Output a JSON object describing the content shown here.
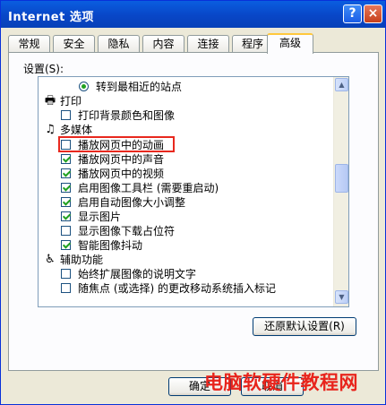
{
  "window": {
    "title": "Internet 选项",
    "help_button": "?",
    "close_button": "×"
  },
  "tabs": [
    {
      "label": "常规",
      "active": false
    },
    {
      "label": "安全",
      "active": false
    },
    {
      "label": "隐私",
      "active": false
    },
    {
      "label": "内容",
      "active": false
    },
    {
      "label": "连接",
      "active": false
    },
    {
      "label": "程序",
      "active": false
    },
    {
      "label": "高级",
      "active": true
    }
  ],
  "settings": {
    "label": "设置(S):",
    "rows": [
      {
        "type": "radio",
        "label": "转到最相近的站点",
        "checked": true
      },
      {
        "type": "category",
        "label": "打印",
        "icon": "printer-icon"
      },
      {
        "type": "checkbox",
        "label": "打印背景颜色和图像",
        "checked": false
      },
      {
        "type": "category",
        "label": "多媒体",
        "icon": "multimedia-icon"
      },
      {
        "type": "checkbox",
        "label": "播放网页中的动画",
        "checked": false
      },
      {
        "type": "checkbox",
        "label": "播放网页中的声音",
        "checked": true
      },
      {
        "type": "checkbox",
        "label": "播放网页中的视频",
        "checked": true
      },
      {
        "type": "checkbox",
        "label": "启用图像工具栏 (需要重启动)",
        "checked": true
      },
      {
        "type": "checkbox",
        "label": "启用自动图像大小调整",
        "checked": true
      },
      {
        "type": "checkbox",
        "label": "显示图片",
        "checked": true
      },
      {
        "type": "checkbox",
        "label": "显示图像下载占位符",
        "checked": false
      },
      {
        "type": "checkbox",
        "label": "智能图像抖动",
        "checked": true
      },
      {
        "type": "category",
        "label": "辅助功能",
        "icon": "accessibility-icon"
      },
      {
        "type": "checkbox",
        "label": "始终扩展图像的说明文字",
        "checked": false
      },
      {
        "type": "checkbox",
        "label": "随焦点 (或选择) 的更改移动系统插入标记",
        "checked": false
      }
    ]
  },
  "buttons": {
    "restore_defaults": "还原默认设置(R)",
    "ok": "确定",
    "cancel": "取消"
  },
  "watermark": "电脑软硬件教程网"
}
